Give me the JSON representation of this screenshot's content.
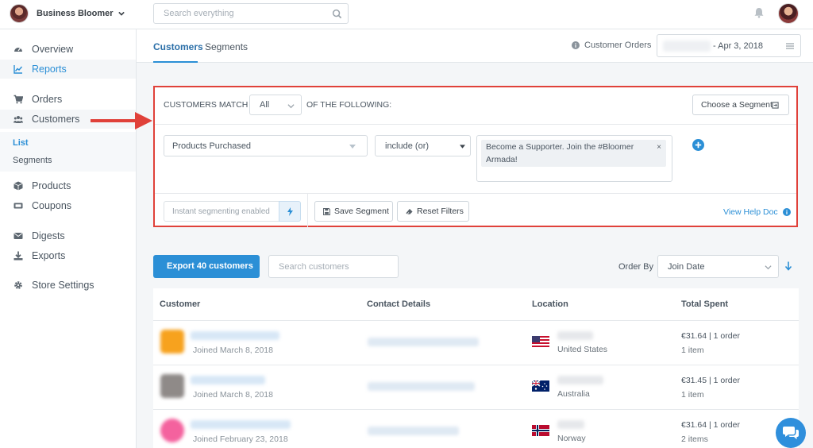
{
  "topbar": {
    "store_name": "Business Bloomer",
    "search_placeholder": "Search everything"
  },
  "sidebar": {
    "items": [
      {
        "label": "Overview",
        "icon": "dashboard-icon"
      },
      {
        "label": "Reports",
        "icon": "line-chart-icon"
      },
      {
        "label": "Orders",
        "icon": "cart-icon"
      },
      {
        "label": "Customers",
        "icon": "users-icon"
      },
      {
        "label": "Products",
        "icon": "box-icon"
      },
      {
        "label": "Coupons",
        "icon": "ticket-icon"
      },
      {
        "label": "Digests",
        "icon": "envelope-icon"
      },
      {
        "label": "Exports",
        "icon": "download-icon"
      },
      {
        "label": "Store Settings",
        "icon": "gear-icon"
      }
    ],
    "sub_items": [
      "List",
      "Segments"
    ]
  },
  "tabs": [
    "Customers",
    "Segments"
  ],
  "header": {
    "customer_orders_label": "Customer Orders",
    "date_range_end": "- Apr 3, 2018"
  },
  "filter": {
    "match_label": "CUSTOMERS MATCH",
    "match_value": "All",
    "following_label": "OF THE FOLLOWING:",
    "choose_segment": "Choose a Segment",
    "condition_field": "Products Purchased",
    "condition_operator": "include (or)",
    "condition_value": "Become a Supporter. Join the #Bloomer Armada!",
    "instant_label": "Instant segmenting enabled",
    "save_segment": "Save Segment",
    "reset_filters": "Reset Filters",
    "help_link": "View Help Doc"
  },
  "toolbar": {
    "export_label": "Export 40 customers",
    "search_placeholder": "Search customers",
    "order_by_label": "Order By",
    "order_by_value": "Join Date"
  },
  "table": {
    "headers": [
      "Customer",
      "Contact Details",
      "Location",
      "Total Spent"
    ],
    "rows": [
      {
        "joined": "Joined March 8, 2018",
        "country": "United States",
        "spent": "€31.64 | 1 order",
        "items": "1 item"
      },
      {
        "joined": "Joined March 8, 2018",
        "country": "Australia",
        "spent": "€31.45 | 1 order",
        "items": "1 item"
      },
      {
        "joined": "Joined February 23, 2018",
        "country": "Norway",
        "spent": "€31.64 | 1 order",
        "items": "2 items"
      }
    ]
  },
  "colors": {
    "accent": "#2b8fd6",
    "highlight_border": "#e0413a",
    "arrow": "#e0413a"
  }
}
